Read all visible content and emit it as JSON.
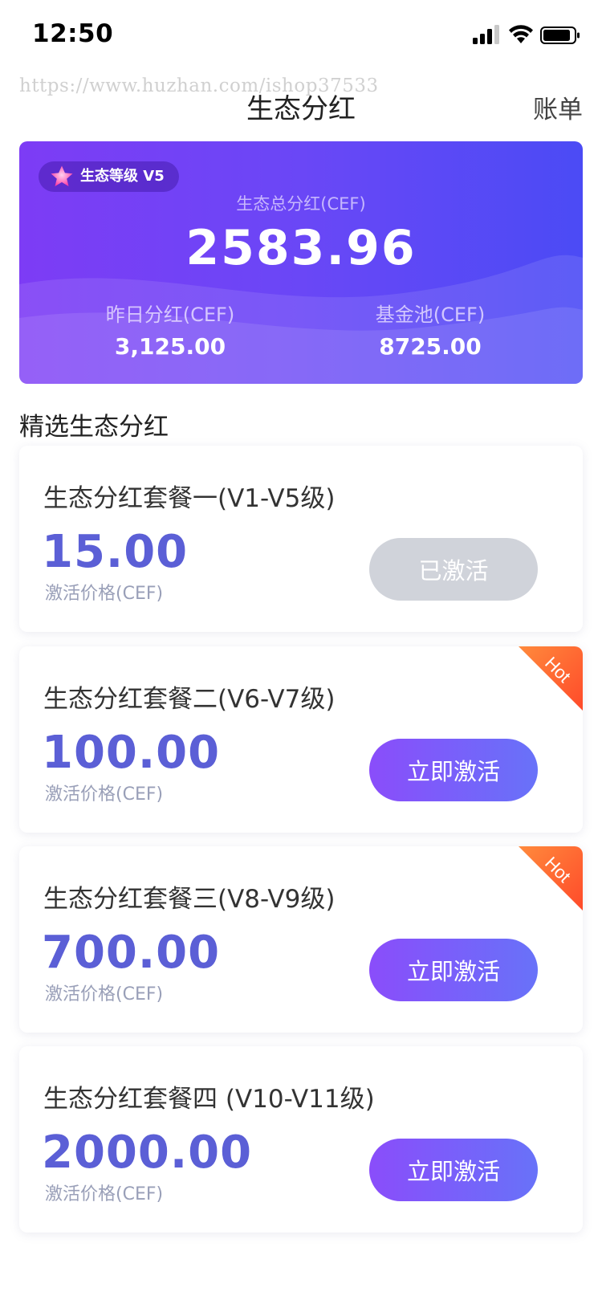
{
  "status_bar": {
    "time": "12:50"
  },
  "watermark": "https://www.huzhan.com/ishop37533",
  "nav": {
    "title": "生态分红",
    "right_action": "账单"
  },
  "hero": {
    "level_badge": "生态等级 V5",
    "total_label": "生态总分红(CEF)",
    "total_value": "2583.96",
    "yesterday_label": "昨日分红(CEF)",
    "yesterday_value": "3,125.00",
    "fund_label": "基金池(CEF)",
    "fund_value": "8725.00"
  },
  "section_title": "精选生态分红",
  "packages": [
    {
      "title": "生态分红套餐一(V1-V5级)",
      "price": "15.00",
      "price_label": "激活价格(CEF)",
      "button": "已激活",
      "hot": false
    },
    {
      "title": "生态分红套餐二(V6-V7级)",
      "price": "100.00",
      "price_label": "激活价格(CEF)",
      "button": "立即激活",
      "hot": true,
      "hot_label": "Hot"
    },
    {
      "title": "生态分红套餐三(V8-V9级)",
      "price": "700.00",
      "price_label": "激活价格(CEF)",
      "button": "立即激活",
      "hot": true,
      "hot_label": "Hot"
    },
    {
      "title": "生态分红套餐四 (V10-V11级)",
      "price": "2000.00",
      "price_label": "激活价格(CEF)",
      "button": "立即激活",
      "hot": false
    }
  ],
  "colors": {
    "accent": "#5b5fd6",
    "hot": "#ff5a2c",
    "disabled": "#d0d3da"
  }
}
